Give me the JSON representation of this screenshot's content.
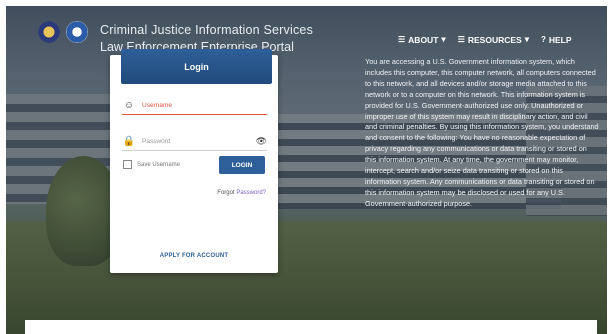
{
  "header": {
    "agency_title": "Criminal Justice Information Services",
    "portal_title": "Law Enforcement Enterprise Portal",
    "seal_icons": [
      "doj-seal-icon",
      "fbi-seal-icon"
    ]
  },
  "nav": {
    "items": [
      {
        "label": "ABOUT",
        "icon": "menu-icon",
        "suffix": "▾"
      },
      {
        "label": "RESOURCES",
        "icon": "menu-icon",
        "suffix": "▾"
      },
      {
        "label": "HELP",
        "icon": "help-icon",
        "suffix": ""
      }
    ]
  },
  "login": {
    "title": "Login",
    "username_placeholder": "Username",
    "password_placeholder": "Password",
    "remember_label": "Save Username",
    "login_button": "LOGIN",
    "forgot_prefix": "Forgot",
    "forgot_link": "Password?",
    "apply_link": "APPLY FOR ACCOUNT"
  },
  "notice": {
    "text": "You are accessing a U.S. Government information system, which includes this computer, this computer network, all computers connected to this network, and all devices and/or storage media attached to this network or to a computer on this network. This information system is provided for U.S. Government-authorized use only. Unauthorized or improper use of this system may result in disciplinary action, and civil and criminal penalties. By using this information system, you understand and consent to the following: You have no reasonable expectation of privacy regarding any communications or data transiting or stored on this information system. At any time, the government may monitor, intercept, search and/or seize data transiting or stored on this information system. Any communications or data transiting or stored on this information system may be disclosed or used for any U.S. Government-authorized purpose."
  },
  "colors": {
    "brand_blue": "#2e5f98",
    "error_red": "#e0553f",
    "link_purple": "#7a5cc9"
  }
}
